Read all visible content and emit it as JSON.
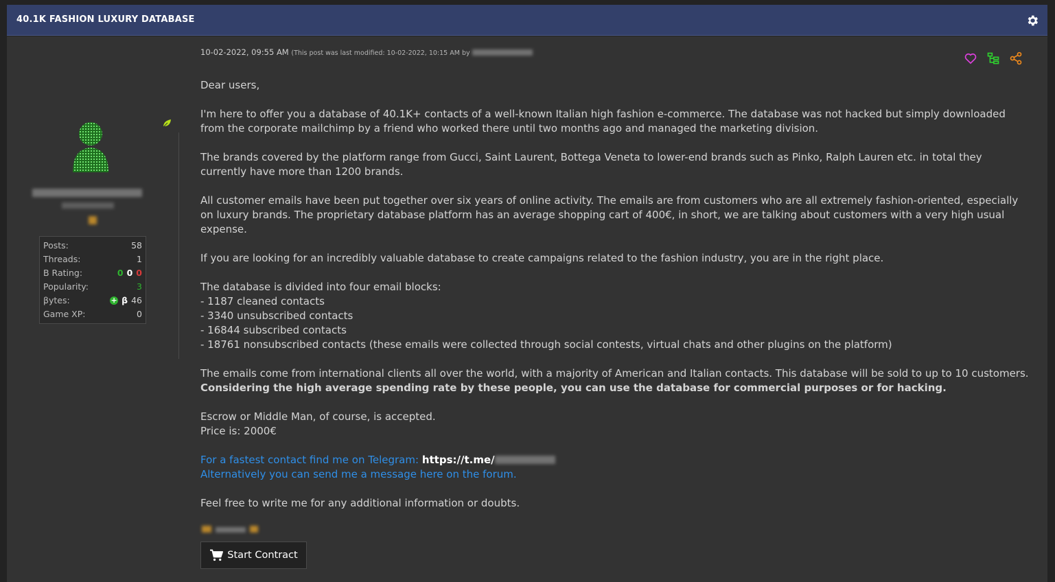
{
  "thread": {
    "title": "40.1K FASHION LUXURY DATABASE"
  },
  "post": {
    "date": "10-02-2022, 09:55 AM",
    "modified_note": "(This post was last modified: 10-02-2022, 10:15 AM by"
  },
  "user_stats": {
    "posts_label": "Posts:",
    "posts_value": "58",
    "threads_label": "Threads:",
    "threads_value": "1",
    "rating_label": "B Rating:",
    "rating_pos": "0",
    "rating_neutral": "0",
    "rating_neg": "0",
    "popularity_label": "Popularity:",
    "popularity_value": "3",
    "bytes_label": "βytes:",
    "bytes_symbol": "β",
    "bytes_value": "46",
    "xp_label": "Game XP:",
    "xp_value": "0"
  },
  "body": {
    "greeting": "Dear users,",
    "p1": "I'm here to offer you a database of 40.1K+ contacts of a well-known Italian high fashion e-commerce. The database was not hacked but simply downloaded from the corporate mailchimp by a friend who worked there until two months ago and managed the marketing division.",
    "p2": "The brands covered by the platform range from Gucci, Saint Laurent, Bottega Veneta to lower-end brands such as Pinko, Ralph Lauren etc. in total they currently have more than 1200 brands.",
    "p3": "All customer emails have been put together over six years of online activity. The emails are from customers who are all extremely fashion-oriented, especially on luxury brands. The proprietary database platform has an average shopping cart of 400€, in short, we are talking about customers with a very high usual expense.",
    "p4": "If you are looking for an incredibly valuable database to create campaigns related to the fashion industry, you are in the right place.",
    "blocks_intro": "The database is divided into four email blocks:",
    "block1": "- 1187 cleaned contacts",
    "block2": "- 3340 unsubscribed contacts",
    "block3": "- 16844 subscribed contacts",
    "block4": "- 18761 nonsubscribed contacts (these emails were collected through social contests, virtual chats and other plugins on the platform)",
    "p5_normal": "The emails come from international clients all over the world, with a majority of American and Italian contacts. This database will be sold to up to 10 customers.",
    "p5_bold": "Considering the high average spending rate by these people, you can use the database for commercial purposes or for hacking.",
    "escrow": "Escrow or Middle Man, of course, is accepted.",
    "price": "Price is: 2000€",
    "telegram_text": "For a fastest contact find me on Telegram:",
    "telegram_url": "https://t.me/",
    "forum_text": "Alternatively you can send me a message here on the forum.",
    "closing": "Feel free to write me for any additional information or doubts."
  },
  "actions": {
    "contract_label": "Start Contract"
  },
  "colors": {
    "header": "#33406a",
    "link": "#2f8fe8",
    "heart": "#e040e0",
    "tree": "#2fd02f",
    "share": "#f08a1c"
  }
}
